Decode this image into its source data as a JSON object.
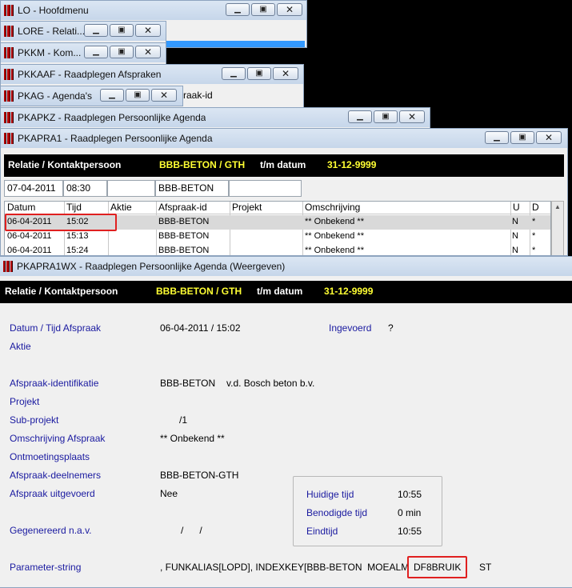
{
  "windows": {
    "lo": {
      "title": "LO - Hoofdmenu"
    },
    "lore": {
      "title": "LORE - Relati..."
    },
    "pkkm": {
      "title": "PKKM - Kom..."
    },
    "pkkaaf": {
      "title": "PKKAAF - Raadplegen Afspraken",
      "partial_text": "raak-id"
    },
    "pkag": {
      "title": "PKAG - Agenda's"
    },
    "pkapkz": {
      "title": "PKAPKZ - Raadplegen Persoonlijke Agenda"
    },
    "pkapra1": {
      "title": "PKAPRA1 - Raadplegen Persoonlijke Agenda"
    },
    "pkapra1wx": {
      "title": "PKAPRA1WX - Raadplegen Persoonlijke Agenda (Weergeven)"
    }
  },
  "header": {
    "relatie_label": "Relatie / Kontaktpersoon",
    "relatie_value": "BBB-BETON / GTH",
    "tm_label": "t/m datum",
    "tm_value": "31-12-9999"
  },
  "filter": {
    "date": "07-04-2011",
    "time": "08:30",
    "empty": "",
    "relatie": "BBB-BETON"
  },
  "table": {
    "columns": [
      "Datum",
      "Tijd",
      "Aktie",
      "Afspraak-id",
      "Projekt",
      "Omschrijving",
      "U",
      "D"
    ],
    "rows": [
      [
        "06-04-2011",
        "15:02",
        "",
        "BBB-BETON",
        "",
        "** Onbekend **",
        "N",
        "*"
      ],
      [
        "06-04-2011",
        "15:13",
        "",
        "BBB-BETON",
        "",
        "** Onbekend **",
        "N",
        "*"
      ],
      [
        "06-04-2011",
        "15:24",
        "",
        "BBB-BETON",
        "",
        "** Onbekend **",
        "N",
        "*"
      ]
    ]
  },
  "detail": {
    "datum_label": "Datum / Tijd Afspraak",
    "datum_value": "06-04-2011 / 15:02",
    "ingevoerd_label": "Ingevoerd",
    "ingevoerd_value": "?",
    "aktie_label": "Aktie",
    "ident_label": "Afspraak-identifikatie",
    "ident_code": "BBB-BETON",
    "ident_name": "v.d. Bosch beton b.v.",
    "projekt_label": "Projekt",
    "subprojekt_label": "Sub-projekt",
    "subprojekt_value": "/1",
    "omschr_label": "Omschrijving Afspraak",
    "omschr_value": "** Onbekend **",
    "plaats_label": "Ontmoetingsplaats",
    "deelnemers_label": "Afspraak-deelnemers",
    "deelnemers_value": "BBB-BETON-GTH",
    "uitgevoerd_label": "Afspraak uitgevoerd",
    "uitgevoerd_value": "Nee",
    "gegenereerd_label": "Gegenereerd n.a.v.",
    "gegenereerd_value": "/      /",
    "param_label": "Parameter-string",
    "param_value": ", FUNKALIAS[LOPD], INDEXKEY[BBB-BETON  MOEALM",
    "param_highlight": "DF8BRUIK",
    "param_tail": "ST",
    "tijd": {
      "huidige_label": "Huidige tijd",
      "huidige_value": "10:55",
      "benodigde_label": "Benodigde tijd",
      "benodigde_value": "0 min",
      "eind_label": "Eindtijd",
      "eind_value": "10:55"
    }
  },
  "colors": {
    "highlight_box": "#e02020",
    "label_blue": "#1a1aa0",
    "header_yellow": "#ffff33"
  }
}
